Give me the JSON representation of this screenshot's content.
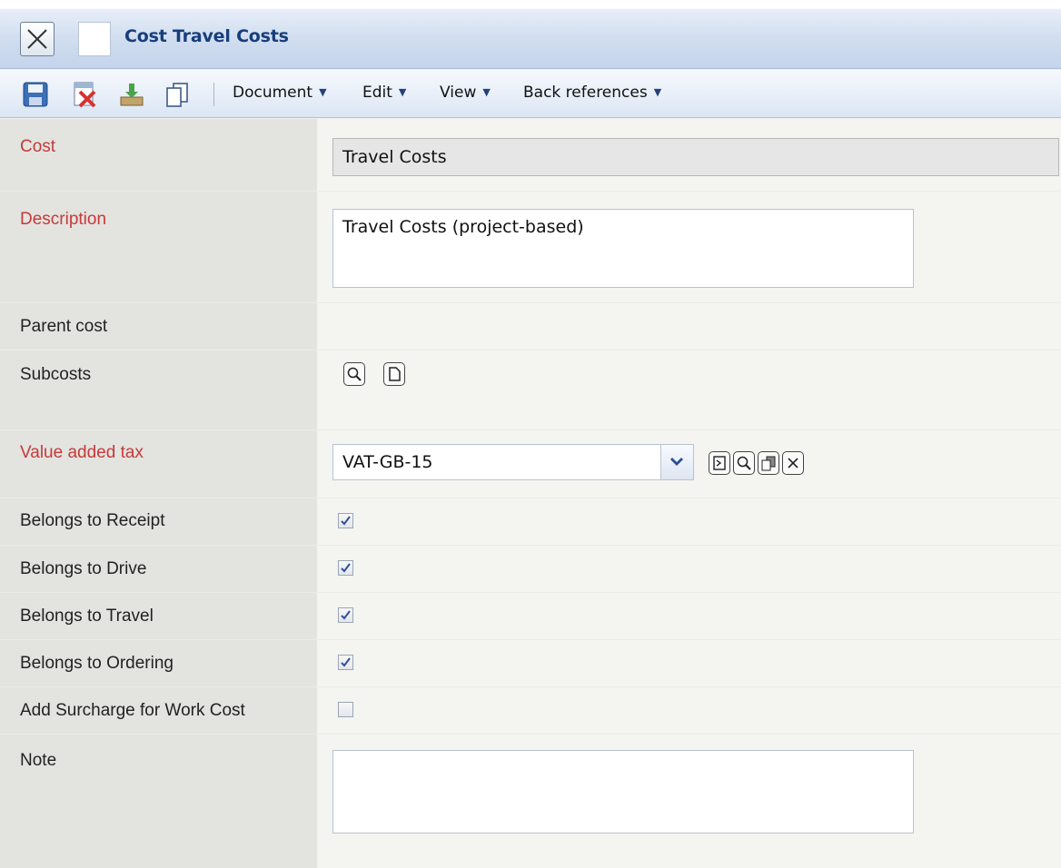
{
  "window": {
    "title": "Cost Travel Costs"
  },
  "toolbar": {
    "icons": [
      "save-icon",
      "delete-icon",
      "download-icon",
      "copy-icon"
    ],
    "menus": [
      {
        "label": "Document"
      },
      {
        "label": "Edit"
      },
      {
        "label": "View"
      },
      {
        "label": "Back references"
      }
    ]
  },
  "form": {
    "cost": {
      "label": "Cost",
      "value": "Travel Costs",
      "required": true,
      "readonly": true
    },
    "description": {
      "label": "Description",
      "value": "Travel Costs (project-based)",
      "required": true
    },
    "parent_cost": {
      "label": "Parent cost"
    },
    "subcosts": {
      "label": "Subcosts",
      "actions": [
        "search-icon",
        "new-document-icon"
      ]
    },
    "vat": {
      "label": "Value added tax",
      "value": "VAT-GB-15",
      "required": true,
      "actions": [
        "open-icon",
        "search-icon",
        "copy-icon",
        "clear-icon"
      ]
    },
    "checkboxes": [
      {
        "label": "Belongs to Receipt",
        "checked": true
      },
      {
        "label": "Belongs to Drive",
        "checked": true
      },
      {
        "label": "Belongs to Travel",
        "checked": true
      },
      {
        "label": "Belongs to Ordering",
        "checked": true
      },
      {
        "label": "Add Surcharge for Work Cost",
        "checked": false
      }
    ],
    "note": {
      "label": "Note",
      "value": ""
    }
  },
  "colors": {
    "required_label": "#c53a3a",
    "title": "#173e7c",
    "label_column": "#e3e3df"
  }
}
